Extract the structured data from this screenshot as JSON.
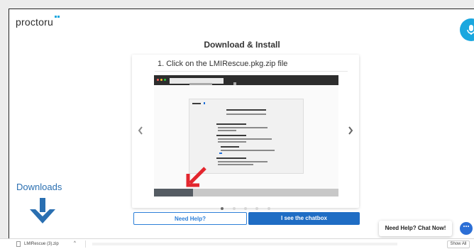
{
  "app": {
    "logo_text": "proctoru"
  },
  "page": {
    "title": "Download & Install"
  },
  "card": {
    "step_text": "1. Click on the LMIRescue.pkg.zip file",
    "pagination_count": 5,
    "active_index": 0
  },
  "buttons": {
    "need_help": "Need Help?",
    "see_chatbox": "I see the chatbox"
  },
  "annotation": {
    "downloads_label": "Downloads"
  },
  "chat": {
    "chat_now_label": "Need Help? Chat Now!"
  },
  "download_bar": {
    "file_name": "LMIRescue (3).zip",
    "show_all": "Show All"
  },
  "colors": {
    "accent_blue": "#1f6dc4",
    "mic_blue": "#1aa7df",
    "downloads_arrow": "#2a6fb1",
    "annotation_red": "#e3262e"
  }
}
